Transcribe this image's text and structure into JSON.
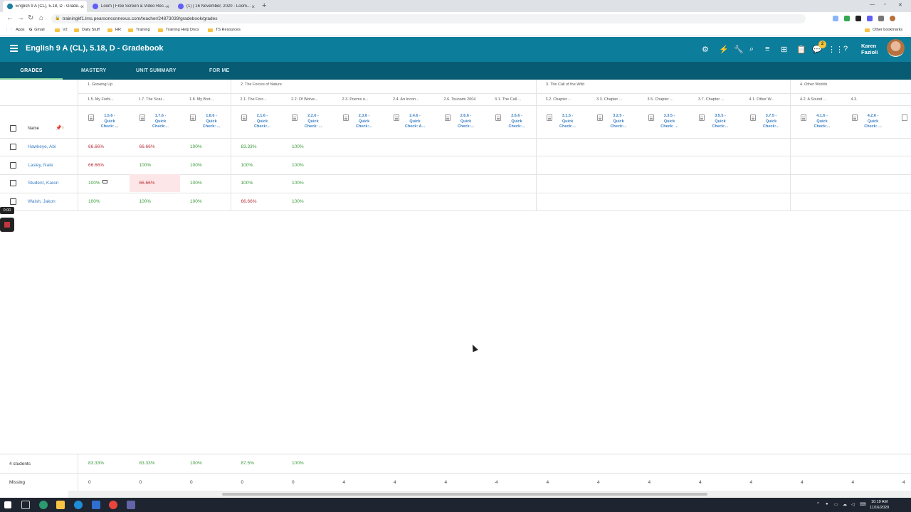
{
  "browser": {
    "tabs": [
      {
        "title": "English 9 A (CL), 5.18, D - Grade...",
        "active": true
      },
      {
        "title": "Loom | Free Screen & Video Rec...",
        "active": false
      },
      {
        "title": "(1) | 16 November, 2020 - Loom...",
        "active": false
      }
    ],
    "url": "trainingkf1.lms.pearsonconnexus.com/teacher/24873039/gradebook/grades",
    "bookmarks": [
      "Apps",
      "Gmail",
      "V2",
      "Daily Stuff",
      "HR",
      "Training",
      "Training Help Docs",
      "TS Resources"
    ],
    "other_bookmarks": "Other bookmarks"
  },
  "app": {
    "title": "English 9 A (CL), 5.18, D - Gradebook",
    "notification_count": "2",
    "user_first": "Karen",
    "user_last": "Fazioli",
    "accent": "#0c7d9a",
    "subnav_bg": "#075b72"
  },
  "subnav": [
    "GRADES",
    "MASTERY",
    "UNIT SUMMARY",
    "FOR ME"
  ],
  "units": [
    "1. Growing Up",
    "2. The Forces of Nature",
    "3. The Call of the Wild",
    "4. Other Worlds"
  ],
  "lessons": [
    "1.5. My Forbi...",
    "1.7. The Scar...",
    "1.8. My Brot...",
    "2.1. The Forc...",
    "2.2. Of Wolve...",
    "2.3. Poems o...",
    "2.4. An Incon...",
    "2.6. Tsunami 2004",
    "3.1. The Call ...",
    "3.2. Chapter ...",
    "3.3. Chapter ...",
    "3.5. Chapter ...",
    "3.7. Chapter ...",
    "4.1. Other W...",
    "4.2. A Sound ...",
    "4.3."
  ],
  "assignments": [
    [
      "1.5.6 -",
      "Quick",
      "Check: ..."
    ],
    [
      "1.7.6 -",
      "Quick",
      "Check:..."
    ],
    [
      "1.8.6 -",
      "Quick",
      "Check: ..."
    ],
    [
      "2.1.6 -",
      "Quick",
      "Check:..."
    ],
    [
      "2.2.6 -",
      "Quick",
      "Check: ..."
    ],
    [
      "2.3.6 -",
      "Quick",
      "Check:..."
    ],
    [
      "2.4.6 -",
      "Quick",
      "Check: A..."
    ],
    [
      "2.6.6 -",
      "Quick",
      "Check:..."
    ],
    [
      "2.6.6 -",
      "Quick",
      "Check:..."
    ],
    [
      "3.1.5 -",
      "Quick",
      "Check:..."
    ],
    [
      "3.2.5 -",
      "Quick",
      "Check:..."
    ],
    [
      "3.3.5 -",
      "Quick",
      "Check: ..."
    ],
    [
      "3.5.5 -",
      "Quick",
      "Check:..."
    ],
    [
      "3.7.5 -",
      "Quick",
      "Check:..."
    ],
    [
      "4.1.6 -",
      "Quick",
      "Check:..."
    ],
    [
      "4.2.6 -",
      "Quick",
      "Check: ..."
    ]
  ],
  "name_header": "Name",
  "students": [
    {
      "name": "Hawkeye, Abi",
      "grades": [
        "66.66%",
        "66.66%",
        "100%",
        "83.33%",
        "100%"
      ]
    },
    {
      "name": "Lasley, Nate",
      "grades": [
        "66.66%",
        "100%",
        "100%",
        "100%",
        "100%"
      ]
    },
    {
      "name": "Student, Karen",
      "grades": [
        "100%",
        "66.66%",
        "100%",
        "100%",
        "100%"
      ]
    },
    {
      "name": "Walsh, Jakon",
      "grades": [
        "100%",
        "100%",
        "100%",
        "66.66%",
        "100%"
      ]
    }
  ],
  "recorder": {
    "time": "0:00"
  },
  "summary": {
    "students_label": "4 students",
    "averages": [
      "83.33%",
      "83.33%",
      "100%",
      "87.5%",
      "100%"
    ],
    "missing_label": "Missing",
    "missing": [
      "0",
      "0",
      "0",
      "0",
      "0",
      "4",
      "4",
      "4",
      "4",
      "4",
      "4",
      "4",
      "4",
      "4",
      "4",
      "4",
      "4"
    ]
  },
  "taskbar": {
    "time": "10:19 AM",
    "date": "11/16/2020"
  }
}
